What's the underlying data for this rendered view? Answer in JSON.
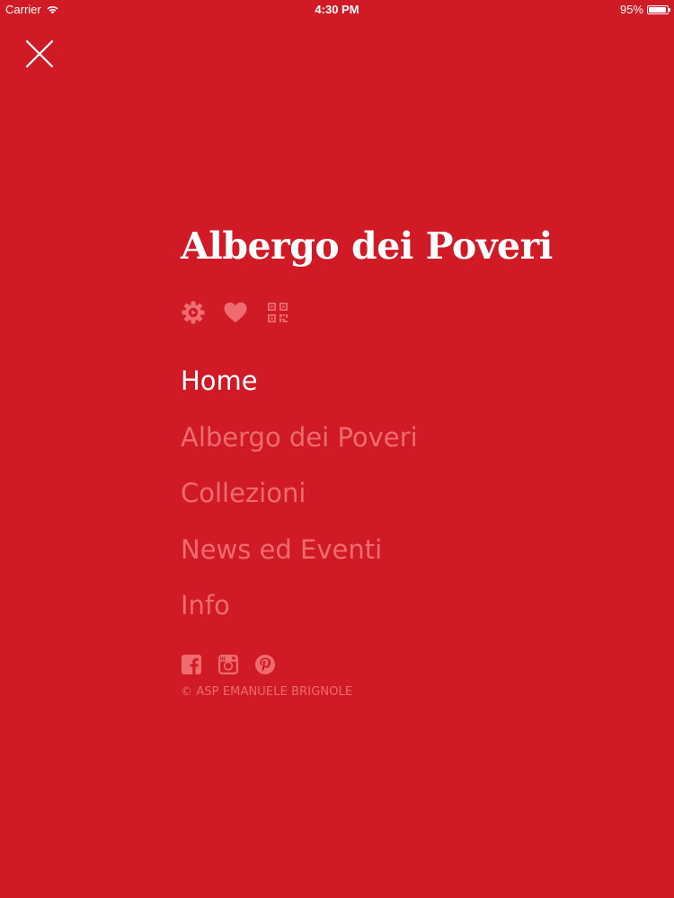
{
  "status_bar": {
    "carrier": "Carrier",
    "time": "4:30 PM",
    "battery": "95%",
    "battery_level": 0.95
  },
  "header": {
    "close_icon": "close-icon",
    "title": "Albergo dei Poveri"
  },
  "toolbar": {
    "icons": [
      "settings-icon",
      "heart-icon",
      "qr-code-icon"
    ]
  },
  "nav": {
    "items": [
      {
        "label": "Home",
        "active": true
      },
      {
        "label": "Albergo dei Poveri",
        "active": false
      },
      {
        "label": "Collezioni",
        "active": false
      },
      {
        "label": "News ed Eventi",
        "active": false
      },
      {
        "label": "Info",
        "active": false
      }
    ]
  },
  "social": {
    "icons": [
      "facebook-icon",
      "instagram-icon",
      "pinterest-icon"
    ]
  },
  "footer": {
    "copyright": "© ASP EMANUELE BRIGNOLE"
  },
  "colors": {
    "background": "#d01a26",
    "text": "#ffffff",
    "muted": "#ee6b6f"
  }
}
